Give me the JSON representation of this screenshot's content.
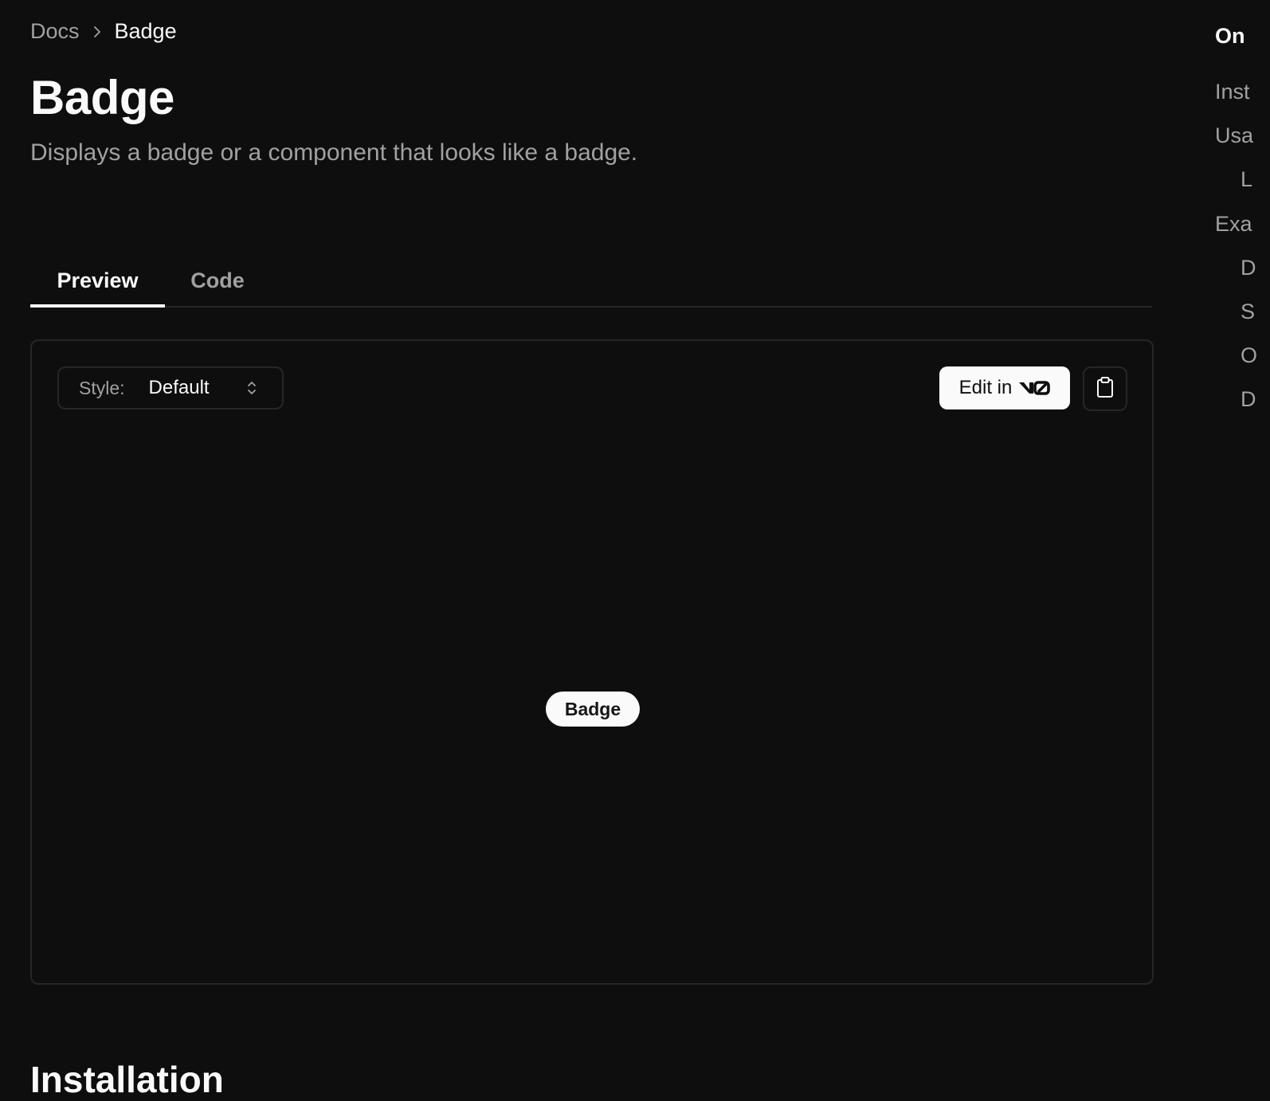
{
  "breadcrumb": {
    "root": "Docs",
    "current": "Badge",
    "separator_icon": "chevron-right-icon"
  },
  "header": {
    "title": "Badge",
    "description": "Displays a badge or a component that looks like a badge."
  },
  "tabs": [
    {
      "label": "Preview",
      "active": true
    },
    {
      "label": "Code",
      "active": false
    }
  ],
  "preview": {
    "style_label": "Style:",
    "style_value": "Default",
    "style_icon": "chevrons-up-down-icon",
    "edit_label": "Edit in",
    "edit_logo": "v0-logo",
    "copy_icon": "clipboard-icon",
    "badge_label": "Badge"
  },
  "next_section": "Installation",
  "toc": {
    "title": "On",
    "items": [
      {
        "label": "Inst",
        "indent": false
      },
      {
        "label": "Usa",
        "indent": false
      },
      {
        "label": "L",
        "indent": true
      },
      {
        "label": "Exa",
        "indent": false
      },
      {
        "label": "D",
        "indent": true
      },
      {
        "label": "S",
        "indent": true
      },
      {
        "label": "O",
        "indent": true
      },
      {
        "label": "D",
        "indent": true
      }
    ]
  },
  "colors": {
    "background": "#0e0e0e",
    "foreground": "#fafafa",
    "muted": "#a1a1a1",
    "border": "#262626"
  }
}
